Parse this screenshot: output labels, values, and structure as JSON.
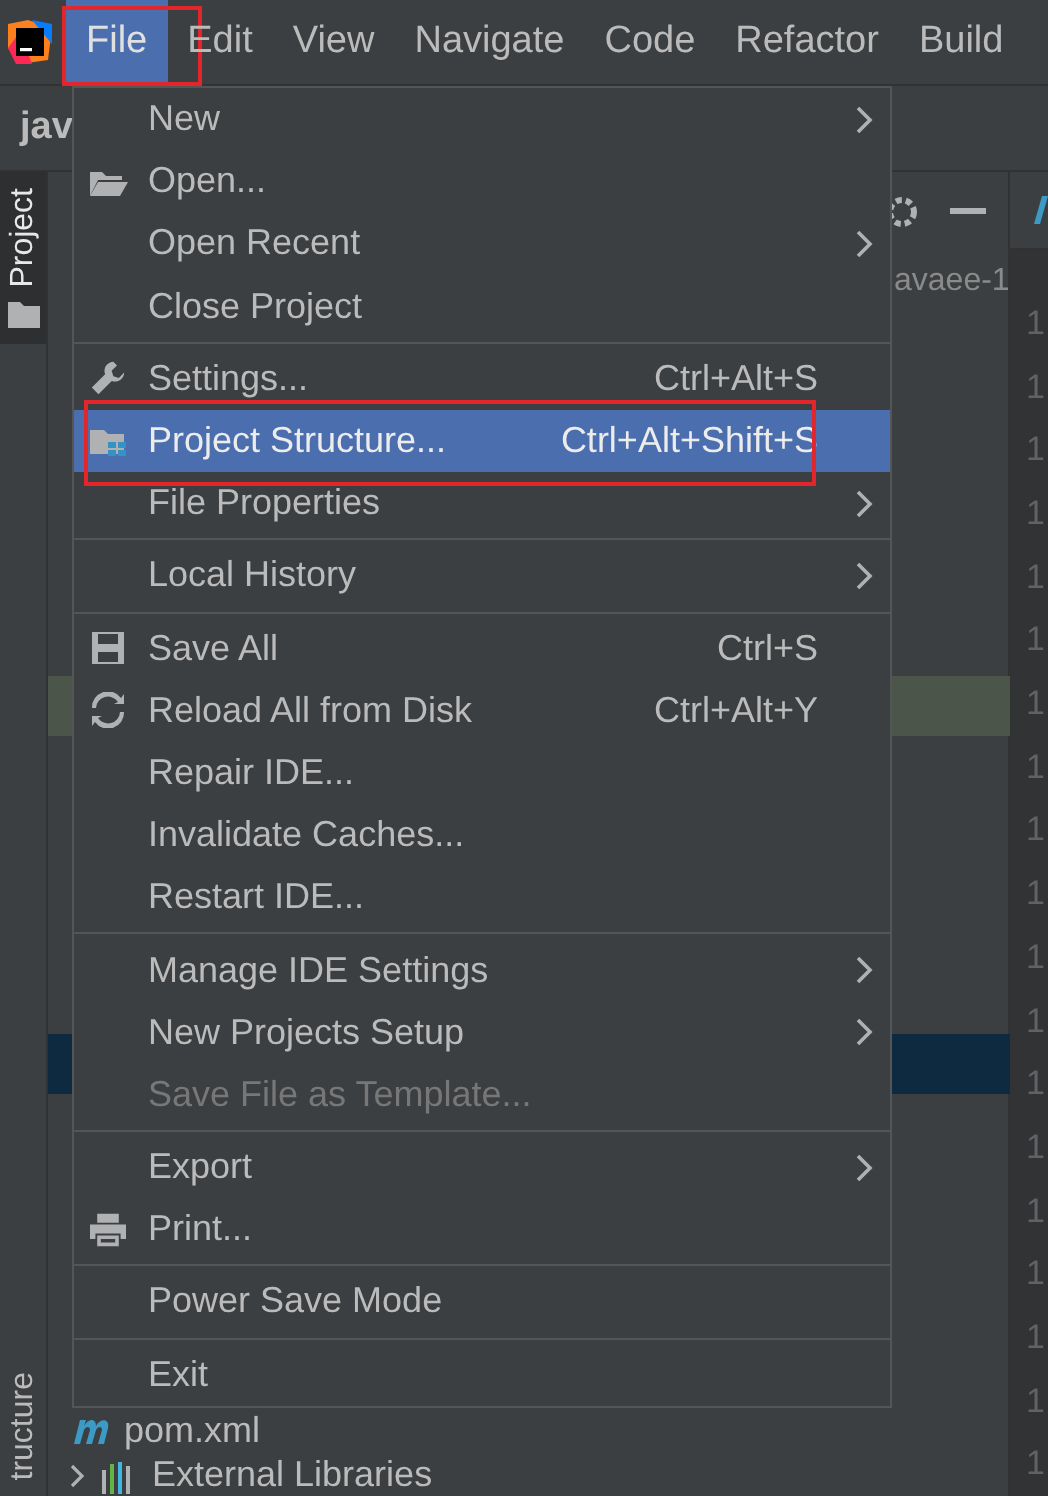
{
  "menubar": {
    "items": [
      {
        "label": "File",
        "selected": true,
        "highlighted": true
      },
      {
        "label": "Edit",
        "selected": false,
        "highlighted": false
      },
      {
        "label": "View",
        "selected": false,
        "highlighted": false
      },
      {
        "label": "Navigate",
        "selected": false,
        "highlighted": false
      },
      {
        "label": "Code",
        "selected": false,
        "highlighted": false
      },
      {
        "label": "Refactor",
        "selected": false,
        "highlighted": false
      },
      {
        "label": "Build",
        "selected": false,
        "highlighted": false
      }
    ]
  },
  "editor_tab": {
    "title": "jav"
  },
  "side_tabs": [
    {
      "label": "Project",
      "selected": true
    },
    {
      "label": "tructure",
      "selected": false
    }
  ],
  "project_panel": {
    "path_text": "avaee-1",
    "bands": [
      {
        "color": "#4b5549"
      },
      {
        "color": "#0e2a40"
      }
    ],
    "rows": [
      {
        "label": "pom.xml"
      },
      {
        "label": "External Libraries",
        "expanded": false
      }
    ]
  },
  "gutter": [
    "1",
    "1",
    "1",
    "1",
    "1",
    "1",
    "1",
    "1",
    "1",
    "1",
    "1",
    "1",
    "1",
    "1",
    "1",
    "1",
    "1",
    "1",
    "1"
  ],
  "file_menu": {
    "items": [
      {
        "kind": "item",
        "label": "New",
        "submenu": true
      },
      {
        "kind": "item",
        "label": "Open..."
      },
      {
        "kind": "item",
        "label": "Open Recent",
        "submenu": true
      },
      {
        "kind": "item",
        "label": "Close Project"
      },
      {
        "kind": "separator"
      },
      {
        "kind": "item",
        "label": "Settings...",
        "shortcut": "Ctrl+Alt+S"
      },
      {
        "kind": "item",
        "label": "Project Structure...",
        "shortcut": "Ctrl+Alt+Shift+S",
        "selected": true,
        "highlighted": true
      },
      {
        "kind": "item",
        "label": "File Properties",
        "submenu": true
      },
      {
        "kind": "separator"
      },
      {
        "kind": "item",
        "label": "Local History",
        "submenu": true
      },
      {
        "kind": "separator"
      },
      {
        "kind": "item",
        "label": "Save All",
        "shortcut": "Ctrl+S"
      },
      {
        "kind": "item",
        "label": "Reload All from Disk",
        "shortcut": "Ctrl+Alt+Y"
      },
      {
        "kind": "item",
        "label": "Repair IDE..."
      },
      {
        "kind": "item",
        "label": "Invalidate Caches..."
      },
      {
        "kind": "item",
        "label": "Restart IDE..."
      },
      {
        "kind": "separator"
      },
      {
        "kind": "item",
        "label": "Manage IDE Settings",
        "submenu": true
      },
      {
        "kind": "item",
        "label": "New Projects Setup",
        "submenu": true
      },
      {
        "kind": "item",
        "label": "Save File as Template...",
        "disabled": true
      },
      {
        "kind": "separator"
      },
      {
        "kind": "item",
        "label": "Export",
        "submenu": true
      },
      {
        "kind": "item",
        "label": "Print..."
      },
      {
        "kind": "separator"
      },
      {
        "kind": "item",
        "label": "Power Save Mode"
      },
      {
        "kind": "separator"
      },
      {
        "kind": "item",
        "label": "Exit"
      }
    ]
  }
}
